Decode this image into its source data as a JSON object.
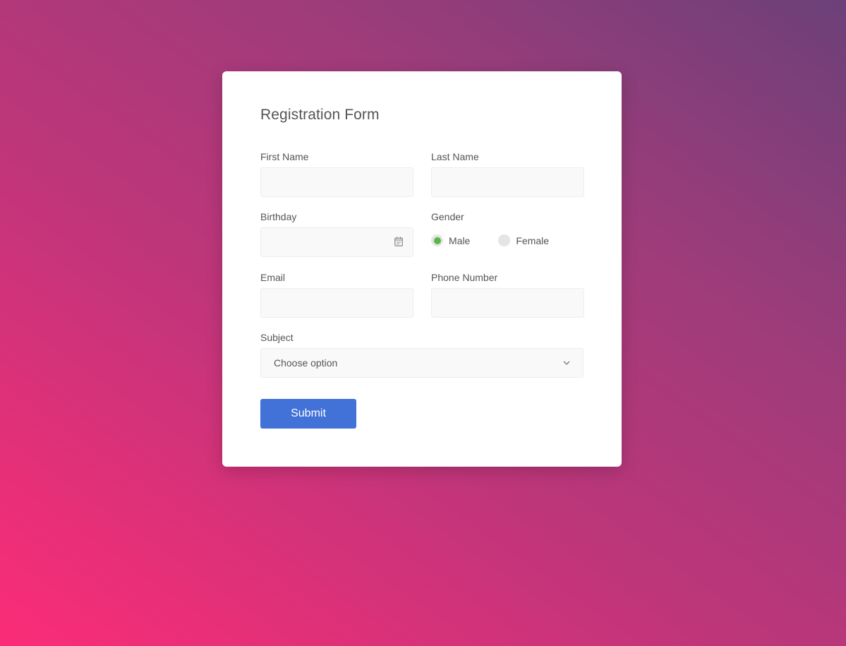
{
  "form": {
    "title": "Registration Form",
    "first_name": {
      "label": "First Name",
      "value": "",
      "placeholder": ""
    },
    "last_name": {
      "label": "Last Name",
      "value": "",
      "placeholder": ""
    },
    "birthday": {
      "label": "Birthday",
      "value": "",
      "icon": "calendar-icon"
    },
    "gender": {
      "label": "Gender",
      "options": [
        {
          "label": "Male",
          "checked": true
        },
        {
          "label": "Female",
          "checked": false
        }
      ]
    },
    "email": {
      "label": "Email",
      "value": "",
      "placeholder": ""
    },
    "phone": {
      "label": "Phone Number",
      "value": "",
      "placeholder": ""
    },
    "subject": {
      "label": "Subject",
      "selected": "Choose option",
      "icon": "chevron-down-icon"
    },
    "submit_label": "Submit"
  },
  "colors": {
    "accent": "#4272d7",
    "radio_checked": "#57b846",
    "background_start": "#fc2c77",
    "background_end": "#6c4079"
  }
}
